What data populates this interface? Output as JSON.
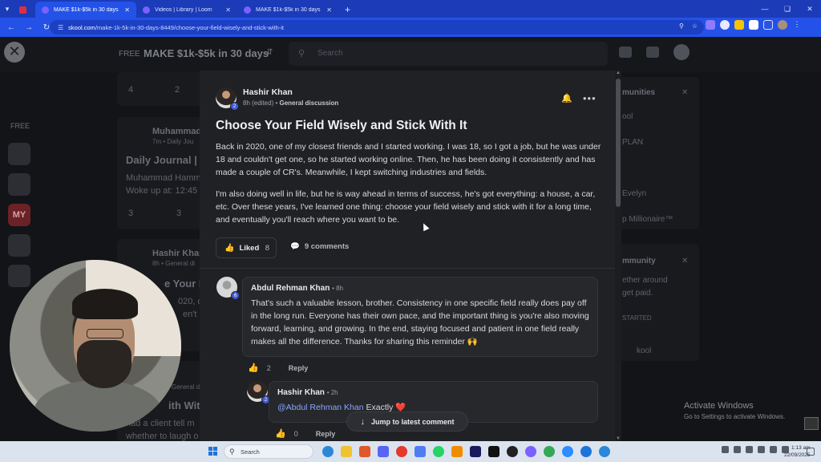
{
  "browser": {
    "tabs": [
      {
        "title": "",
        "favicon": "youtube-icon",
        "pinned": true
      },
      {
        "title": "MAKE $1k-$5k in 30 days",
        "active": true
      },
      {
        "title": "Videos | Library | Loom",
        "active": false
      },
      {
        "title": "MAKE $1k-$5k in 30 days - Goo",
        "active": false
      }
    ],
    "new_tab": "+",
    "url_domain": "skool.com",
    "url_path": "/make-1k-5k-in-30-days-8449/choose-your-field-wisely-and-stick-with-it"
  },
  "background": {
    "free_label": "FREE",
    "brand": "MAKE $1k-$5k in 30 days",
    "search_placeholder": "Search",
    "side_free": "FREE",
    "side_my": "MY",
    "notif_count_1": "7",
    "notif_count_2": "4",
    "feed": [
      {
        "author": "Muhammad",
        "meta": "7m • Daily Jou",
        "title": "Daily Journal | S",
        "line1": "Muhammad Hamm",
        "line2": "Woke up at: 12:45",
        "likes": "3",
        "comments": "3"
      },
      {
        "author": "Hashir Khan",
        "meta": "8h • General di",
        "title": "e Your Fi",
        "line1": "020, one c",
        "line2": "en't get o",
        "likes": "",
        "comments": ""
      },
      {
        "author": "",
        "meta": "General d",
        "title": "ith With L",
        "line1": "had a client tell m",
        "line2": "whether to laugh o",
        "likes": "",
        "comments": ""
      }
    ],
    "top_counts": {
      "likes": "4",
      "comments": "2"
    },
    "right_panel": [
      {
        "lines": [
          "munities",
          "ool",
          "PLAN",
          "Evelyn",
          "p Millionaire™"
        ]
      },
      {
        "lines": [
          "mmunity",
          "ether around",
          "get paid.",
          "STARTED",
          "kool"
        ]
      }
    ],
    "activate_windows_title": "Activate Windows",
    "activate_windows_sub": "Go to Settings to activate Windows."
  },
  "post": {
    "author": "Hashir Khan",
    "author_level": "2",
    "time": "8h (edited)",
    "category": "General discussion",
    "title": "Choose Your Field Wisely and Stick With It",
    "paragraphs": [
      "Back in 2020, one of my closest friends and I started working. I was 18, so I got a job, but he was under 18 and couldn't get one, so he started working online. Then, he has been doing it consistently and has made a couple of CR's. Meanwhile, I kept switching industries and fields.",
      "I'm also doing well in life, but he is way ahead in terms of success, he's got everything: a house, a car, etc. Over these years, I've learned one thing: choose your field wisely and stick with it for a long time, and eventually you'll reach where you want to be."
    ],
    "like_label": "Liked",
    "like_count": "8",
    "comments_label": "9 comments"
  },
  "comments": [
    {
      "author": "Abdul Rehman Khan",
      "level": "6",
      "time": "8h",
      "text": "That's such a valuable lesson, brother. Consistency in one specific field really does pay off in the long run. Everyone has their own pace, and the important thing is you're also moving forward, learning, and growing. In the end, staying focused and patient in one field really makes all the difference. Thanks for sharing this reminder 🙌",
      "likes": "2",
      "reply_label": "Reply"
    },
    {
      "author": "Hashir Khan",
      "level": "2",
      "time": "2h",
      "mention": "@Abdul Rehman Khan",
      "text": "Exactly ❤️",
      "likes": "0",
      "reply_label": "Reply"
    }
  ],
  "jump_label": "Jump to latest comment",
  "taskbar": {
    "search_placeholder": "Search",
    "time": "1:13 am",
    "date": "22/09/2025"
  },
  "colors": {
    "accent_blue": "#2452e8",
    "like_yellow": "#e8b53a",
    "mention": "#8aa6ff"
  }
}
